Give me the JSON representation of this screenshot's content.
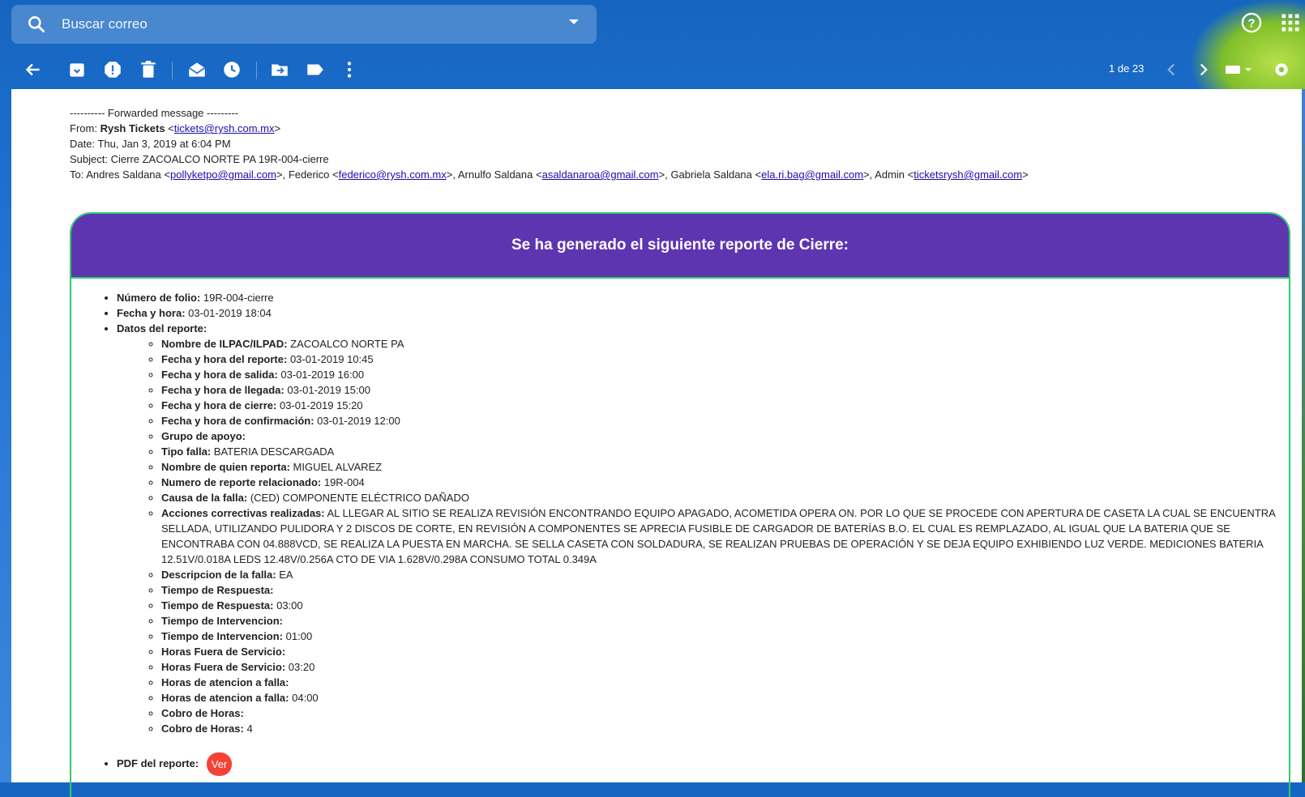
{
  "search": {
    "placeholder": "Buscar correo"
  },
  "toolbar": {
    "pager": "1 de 23",
    "actions": [
      "back-icon",
      "archive-icon",
      "report-spam-icon",
      "delete-icon",
      "mark-unread-icon",
      "snooze-icon",
      "move-to-icon",
      "label-icon",
      "more-icon"
    ]
  },
  "forwarded": {
    "header": "---------- Forwarded message ---------",
    "from_label": "From:",
    "from_name": "Rysh Tickets",
    "from_email": "tickets@rysh.com.mx",
    "date_label": "Date:",
    "date": "Thu, Jan 3, 2019 at 6:04 PM",
    "subject_label": "Subject:",
    "subject": "Cierre ZACOALCO NORTE PA 19R-004-cierre",
    "to_label": "To:",
    "recipients": [
      {
        "name": "Andres Saldana",
        "email": "pollyketpo@gmail.com"
      },
      {
        "name": "Federico",
        "email": "federico@rysh.com.mx"
      },
      {
        "name": "Arnulfo Saldana",
        "email": "asaldanaroa@gmail.com"
      },
      {
        "name": "Gabriela Saldana",
        "email": "ela.ri.bag@gmail.com"
      },
      {
        "name": "Admin",
        "email": "ticketsrysh@gmail.com"
      }
    ]
  },
  "report": {
    "title": "Se ha generado el siguiente reporte de Cierre:",
    "folio_label": "Número de folio:",
    "folio": "19R-004-cierre",
    "fecha_label": "Fecha y hora:",
    "fecha": "03-01-2019 18:04",
    "datos_label": "Datos del reporte:",
    "items": [
      {
        "label": "Nombre de ILPAC/ILPAD:",
        "value": "ZACOALCO NORTE PA"
      },
      {
        "label": "Fecha y hora del reporte:",
        "value": "03-01-2019 10:45"
      },
      {
        "label": "Fecha y hora de salida:",
        "value": "03-01-2019 16:00"
      },
      {
        "label": "Fecha y hora de llegada:",
        "value": "03-01-2019 15:00"
      },
      {
        "label": "Fecha y hora de cierre:",
        "value": "03-01-2019 15:20"
      },
      {
        "label": "Fecha y hora de confirmación:",
        "value": "03-01-2019 12:00"
      },
      {
        "label": "Grupo de apoyo:",
        "value": ""
      },
      {
        "label": "Tipo falla:",
        "value": "BATERIA DESCARGADA"
      },
      {
        "label": "Nombre de quien reporta:",
        "value": "MIGUEL ALVAREZ"
      },
      {
        "label": "Numero de reporte relacionado:",
        "value": "19R-004"
      },
      {
        "label": "Causa de la falla:",
        "value": "(CED) COMPONENTE ELÉCTRICO DAÑADO"
      },
      {
        "label": "Acciones correctivas realizadas:",
        "value": "AL LLEGAR AL SITIO SE REALIZA REVISIÓN ENCONTRANDO EQUIPO APAGADO, ACOMETIDA OPERA ON. POR LO QUE SE PROCEDE CON APERTURA DE CASETA LA CUAL SE ENCUENTRA SELLADA, UTILIZANDO PULIDORA Y 2 DISCOS DE CORTE, EN REVISIÓN A COMPONENTES SE APRECIA FUSIBLE DE CARGADOR DE BATERÍAS B.O. EL CUAL ES REMPLAZADO, AL IGUAL QUE LA BATERIA QUE SE ENCONTRABA CON 04.888VCD, SE REALIZA LA PUESTA EN MARCHA. SE SELLA CASETA CON SOLDADURA, SE REALIZAN PRUEBAS DE OPERACIÓN Y SE DEJA EQUIPO EXHIBIENDO LUZ VERDE. MEDICIONES BATERIA 12.51V/0.018A LEDS 12.48V/0.256A CTO DE VIA 1.628V/0.298A CONSUMO TOTAL 0.349A"
      },
      {
        "label": "Descripcion de la falla:",
        "value": "EA"
      },
      {
        "label": "Tiempo de Respuesta:",
        "value": ""
      },
      {
        "label": "Tiempo de Respuesta:",
        "value": "03:00"
      },
      {
        "label": "Tiempo de Intervencion:",
        "value": ""
      },
      {
        "label": "Tiempo de Intervencion:",
        "value": "01:00"
      },
      {
        "label": "Horas Fuera de Servicio:",
        "value": ""
      },
      {
        "label": "Horas Fuera de Servicio:",
        "value": "03:20"
      },
      {
        "label": "Horas de atencion a falla:",
        "value": ""
      },
      {
        "label": "Horas de atencion a falla:",
        "value": "04:00"
      },
      {
        "label": "Cobro de Horas:",
        "value": ""
      },
      {
        "label": "Cobro de Horas:",
        "value": "4"
      }
    ],
    "pdf_label": "PDF del reporte:",
    "pdf_button": "Ver"
  }
}
